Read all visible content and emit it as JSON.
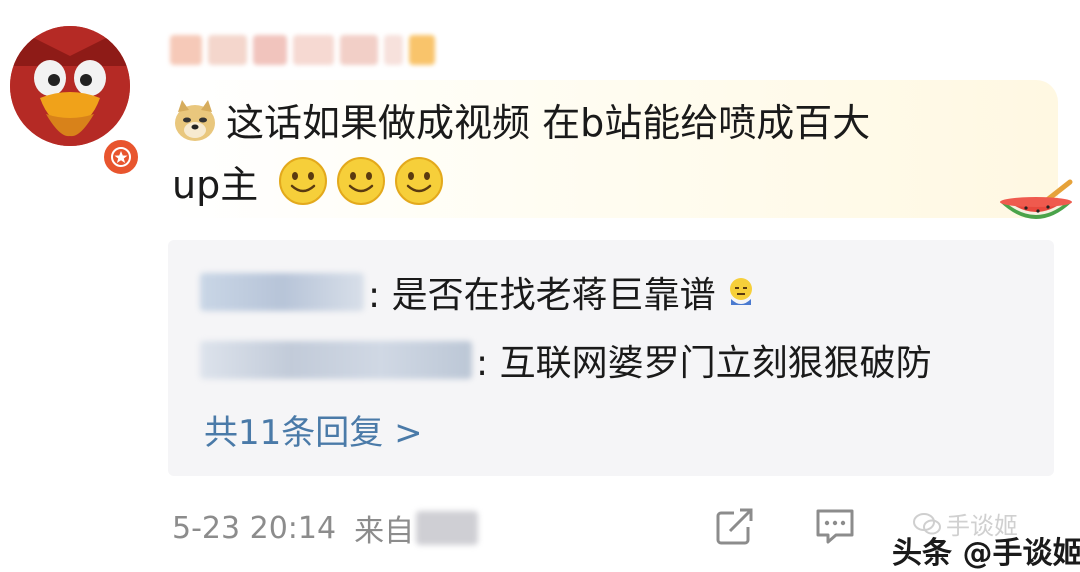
{
  "comment": {
    "line1": "这话如果做成视频 在b站能给喷成百大",
    "line2": "up主"
  },
  "replies": [
    {
      "text": ": 是否在找老蒋巨靠谱"
    },
    {
      "text": ": 互联网婆罗门立刻狠狠破防"
    }
  ],
  "reply_count_label": "共11条回复 >",
  "meta": {
    "timestamp": "5-23 20:14",
    "source_prefix": "来自"
  },
  "watermark": {
    "top_text": "手谈姬",
    "text": "头条 @手谈姬"
  },
  "icons": {
    "avatar": "cartoon-bird-avatar",
    "badge": "vip-star-badge",
    "doge": "doge-emoji",
    "smile": "smile-emoji",
    "watermelon": "watermelon-decoration",
    "repost": "share-icon",
    "comment": "comment-icon"
  },
  "colors": {
    "link": "#4a7aa8",
    "meta": "#8c8c8c",
    "reply_bg": "#f5f5f7",
    "badge": "#e8552e"
  }
}
